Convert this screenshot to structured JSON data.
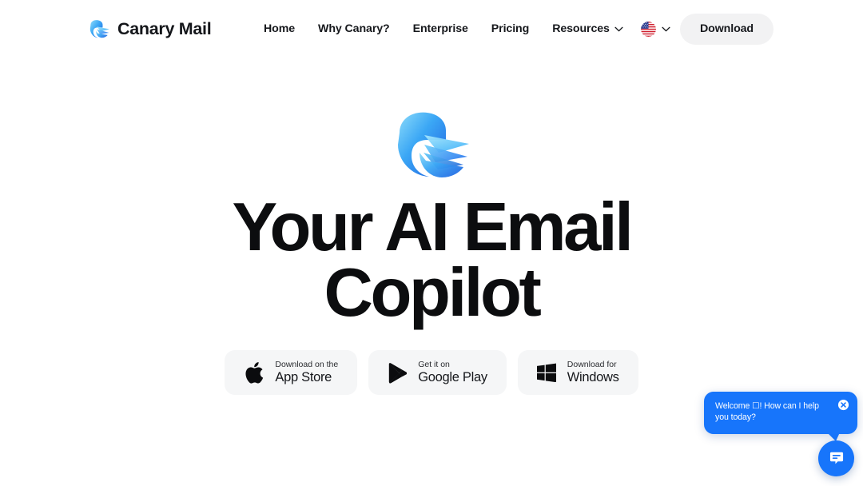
{
  "header": {
    "brand": {
      "name": "Canary Mail",
      "logo_icon": "canary-bird-logo"
    },
    "nav_items": [
      {
        "label": "Home",
        "has_caret": false
      },
      {
        "label": "Why Canary?",
        "has_caret": false
      },
      {
        "label": "Enterprise",
        "has_caret": false
      },
      {
        "label": "Pricing",
        "has_caret": false
      },
      {
        "label": "Resources",
        "has_caret": true
      }
    ],
    "language": {
      "flag_icon": "us-flag-icon",
      "caret_icon": "chevron-down-icon"
    },
    "download_label": "Download"
  },
  "hero": {
    "logo_icon": "canary-bird-logo-large",
    "title_lines": [
      "Your AI Email",
      "Copilot"
    ],
    "store_buttons": [
      {
        "icon": "apple-icon",
        "small": "Download on the",
        "big": "App Store"
      },
      {
        "icon": "google-play-icon",
        "small": "Get it on",
        "big": "Google Play"
      },
      {
        "icon": "windows-icon",
        "small": "Download for",
        "big": "Windows"
      }
    ]
  },
  "chat_widget": {
    "message": "Welcome ☐! How can I help you today?",
    "close_icon": "close-circle-icon",
    "fab_icon": "chat-bubble-icon"
  },
  "colors": {
    "accent_blue": "#1775fb",
    "logo_blue_light": "#7cd2f7",
    "logo_blue_mid": "#3ba7f5",
    "logo_blue_deep": "#1f5fe0",
    "text_dark": "#14161a",
    "pill_bg": "#f2f2f3",
    "store_bg": "#f5f6f7",
    "page_bg": "#ffffff"
  }
}
